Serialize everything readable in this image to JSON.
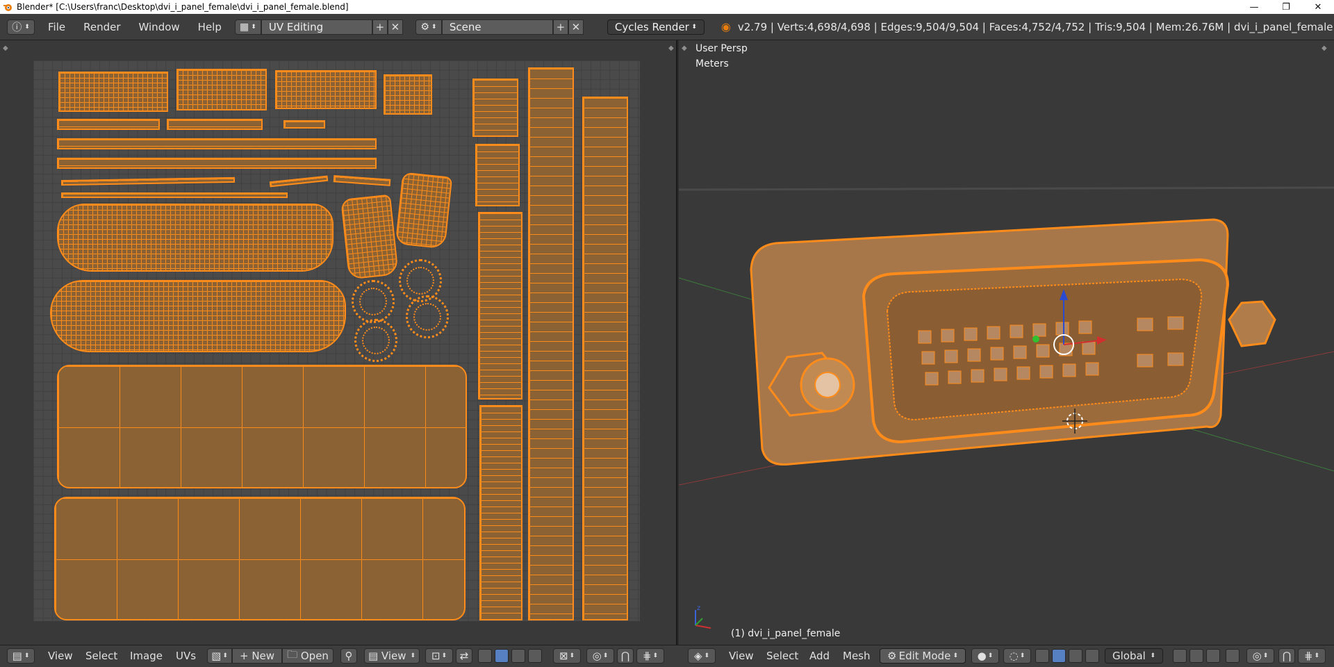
{
  "window": {
    "title": "Blender* [C:\\Users\\franc\\Desktop\\dvi_i_panel_female\\dvi_i_panel_female.blend]",
    "minimize": "—",
    "maximize": "❐",
    "close": "✕"
  },
  "info_header": {
    "menus": [
      "File",
      "Render",
      "Window",
      "Help"
    ],
    "screen_layout": "UV Editing",
    "scene": "Scene",
    "render_engine": "Cycles Render",
    "stats": "v2.79 | Verts:4,698/4,698 | Edges:9,504/9,504 | Faces:4,752/4,752 | Tris:9,504 | Mem:26.76M | dvi_i_panel_female"
  },
  "viewport": {
    "view_name": "User Persp",
    "units": "Meters",
    "object_label": "(1) dvi_i_panel_female"
  },
  "uv_header": {
    "menus": [
      "View",
      "Select",
      "Image",
      "UVs"
    ],
    "new_label": "New",
    "open_label": "Open",
    "view_label": "View"
  },
  "view3d_header": {
    "menus": [
      "View",
      "Select",
      "Add",
      "Mesh"
    ],
    "mode": "Edit Mode",
    "orientation": "Global"
  },
  "colors": {
    "accent": "#ff8c1a",
    "face_fill": "#8a6233",
    "header_bg": "#3d3d3d",
    "area_bg": "#393939",
    "active_blue": "#5680c2"
  },
  "icons": {
    "blender_logo": "blender-icon",
    "info_editor": "info-icon",
    "screen": "screen-layout-icon",
    "scene": "scene-icon",
    "add": "plus-icon",
    "remove": "x-icon",
    "uv_editor": "image-editor-icon",
    "view3d_editor": "cube-icon",
    "pin": "pin-icon"
  }
}
